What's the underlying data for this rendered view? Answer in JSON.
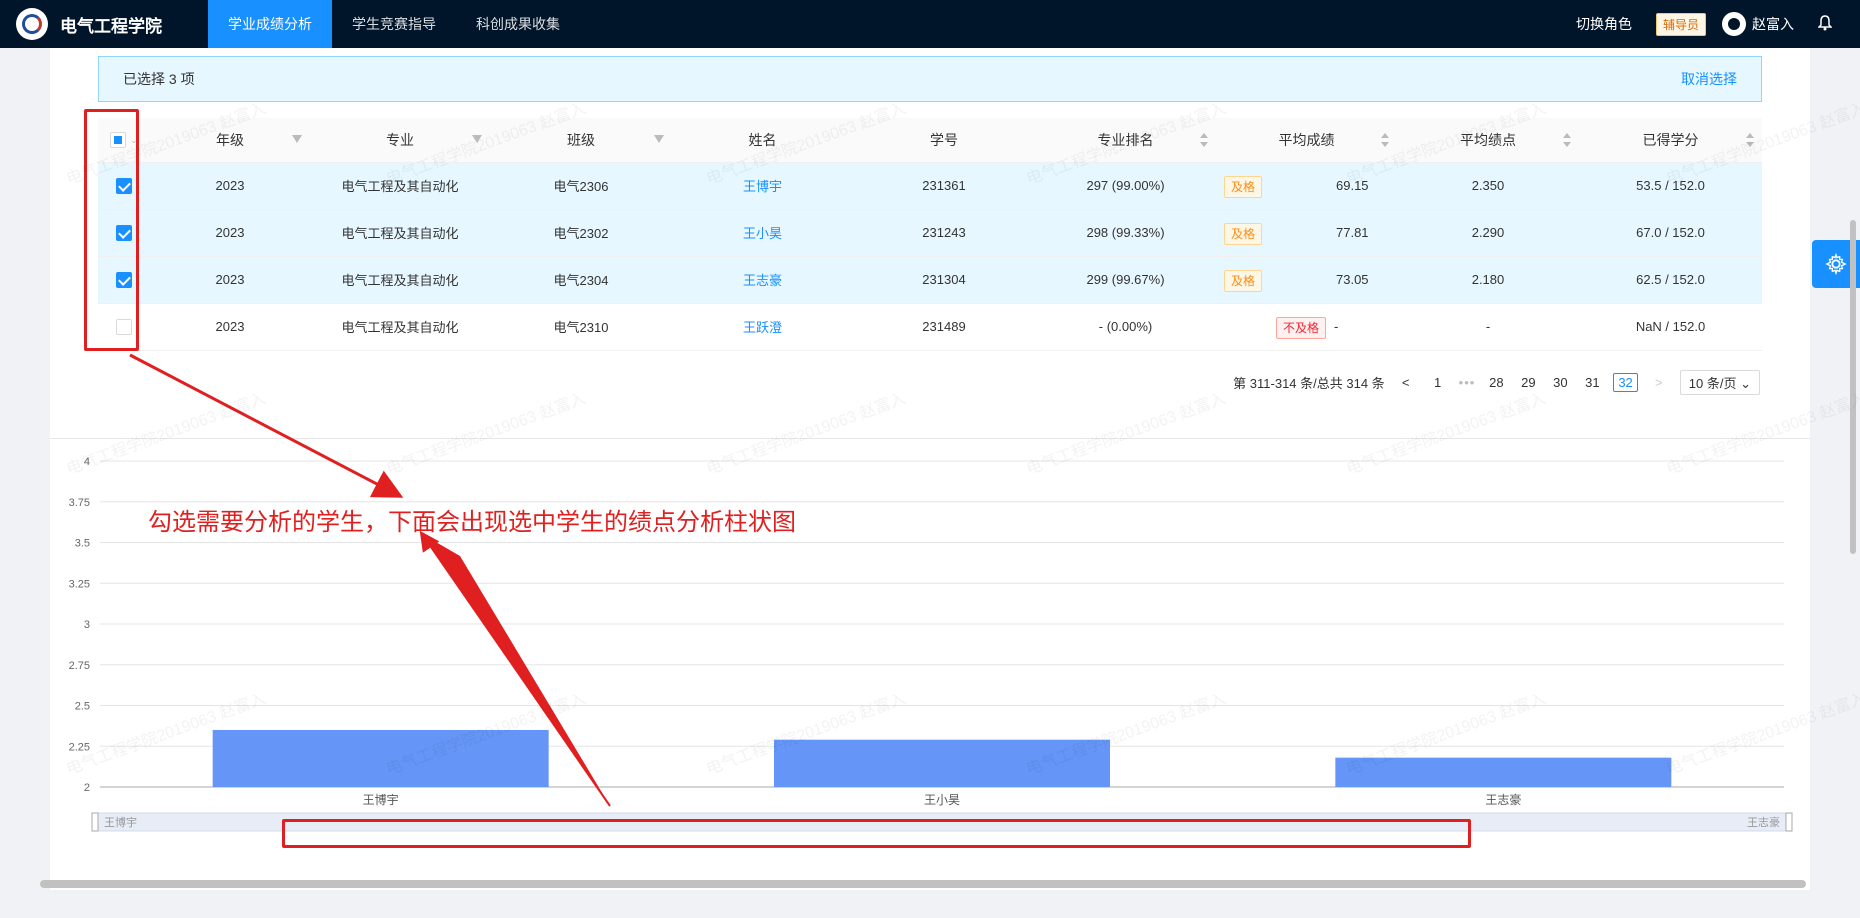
{
  "nav": {
    "brand": "电气工程学院",
    "items": [
      {
        "label": "学业成绩分析",
        "active": true
      },
      {
        "label": "学生竞赛指导",
        "active": false
      },
      {
        "label": "科创成果收集",
        "active": false
      }
    ],
    "switch_role": "切换角色",
    "role": "辅导员",
    "user": "赵富入",
    "bell_icon": "bell-icon"
  },
  "selection": {
    "text": "已选择 3 项",
    "cancel": "取消选择"
  },
  "table": {
    "headers": [
      "年级",
      "专业",
      "班级",
      "姓名",
      "学号",
      "专业排名",
      "平均成绩",
      "平均绩点",
      "已得学分"
    ],
    "rows": [
      {
        "checked": true,
        "grade": "2023",
        "major": "电气工程及其自动化",
        "class": "电气2306",
        "name": "王博宇",
        "id": "231361",
        "rank": "297 (99.00%)",
        "tag": "及格",
        "tag_type": "pass",
        "score": "69.15",
        "gpa": "2.350",
        "credits": "53.5 / 152.0"
      },
      {
        "checked": true,
        "grade": "2023",
        "major": "电气工程及其自动化",
        "class": "电气2302",
        "name": "王小昊",
        "id": "231243",
        "rank": "298 (99.33%)",
        "tag": "及格",
        "tag_type": "pass",
        "score": "77.81",
        "gpa": "2.290",
        "credits": "67.0 / 152.0"
      },
      {
        "checked": true,
        "grade": "2023",
        "major": "电气工程及其自动化",
        "class": "电气2304",
        "name": "王志豪",
        "id": "231304",
        "rank": "299 (99.67%)",
        "tag": "及格",
        "tag_type": "pass",
        "score": "73.05",
        "gpa": "2.180",
        "credits": "62.5 / 152.0"
      },
      {
        "checked": false,
        "grade": "2023",
        "major": "电气工程及其自动化",
        "class": "电气2310",
        "name": "王跃澄",
        "id": "231489",
        "rank": "- (0.00%)",
        "tag": "不及格",
        "tag_type": "fail",
        "score": "-",
        "gpa": "-",
        "credits": "NaN / 152.0"
      }
    ]
  },
  "pager": {
    "summary": "第 311-314 条/总共 314 条",
    "prev": "<",
    "next": ">",
    "pages": [
      "1",
      "28",
      "29",
      "30",
      "31",
      "32"
    ],
    "dots": "•••",
    "current": "32",
    "size": "10 条/页"
  },
  "annotation": "勾选需要分析的学生，下面会出现选中学生的绩点分析柱状图",
  "watermark": "电气工程学院2019063 赵富入",
  "chart_data": {
    "type": "bar",
    "categories": [
      "王博宇",
      "王小昊",
      "王志豪"
    ],
    "values": [
      2.35,
      2.29,
      2.18
    ],
    "ylim": [
      2,
      4
    ],
    "yticks": [
      "2",
      "2.25",
      "2.5",
      "2.75",
      "3",
      "3.25",
      "3.5",
      "3.75",
      "4"
    ],
    "bar_color": "#6495f7",
    "grid": true,
    "zoom_labels": [
      "王博宇",
      "王志豪"
    ]
  }
}
